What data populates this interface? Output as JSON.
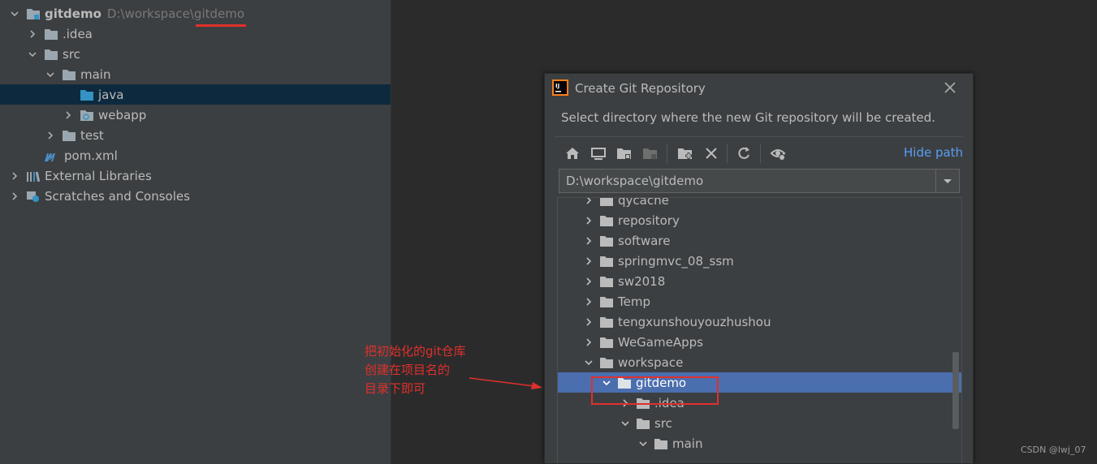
{
  "project_tree": {
    "root": {
      "name": "gitdemo",
      "path": "D:\\workspace\\gitdemo"
    },
    "items": [
      {
        "label": ".idea"
      },
      {
        "label": "src"
      },
      {
        "label": "main"
      },
      {
        "label": "java"
      },
      {
        "label": "webapp"
      },
      {
        "label": "test"
      },
      {
        "label": "pom.xml"
      },
      {
        "label": "External Libraries"
      },
      {
        "label": "Scratches and Consoles"
      }
    ]
  },
  "dialog": {
    "title": "Create Git Repository",
    "description": "Select directory where the new Git repository will be created.",
    "hide_path_label": "Hide path",
    "path_value": "D:\\workspace\\gitdemo",
    "tree": [
      {
        "label": "qycache"
      },
      {
        "label": "repository"
      },
      {
        "label": "software"
      },
      {
        "label": "springmvc_08_ssm"
      },
      {
        "label": "sw2018"
      },
      {
        "label": "Temp"
      },
      {
        "label": "tengxunshouyouzhushou"
      },
      {
        "label": "WeGameApps"
      },
      {
        "label": "workspace"
      },
      {
        "label": "gitdemo"
      },
      {
        "label": ".idea"
      },
      {
        "label": "src"
      },
      {
        "label": "main"
      }
    ]
  },
  "annotation": {
    "lines": [
      "把初始化的git仓库",
      "创建在项目名的",
      "目录下即可"
    ],
    "color": "#e0302c"
  },
  "watermark": "CSDN @lwj_07",
  "colors": {
    "folder": "#9aa7b0",
    "selection": "#4b6eaf",
    "link": "#589df6"
  }
}
